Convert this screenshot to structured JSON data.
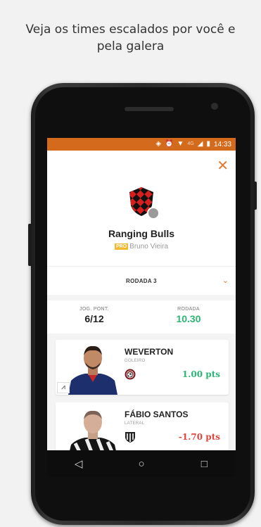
{
  "headline": {
    "line1": "Veja os times escalados por você e",
    "line2": "pela galera"
  },
  "status_bar": {
    "time": "14:33",
    "network": "4G",
    "icons": [
      "vibrate-icon",
      "alarm-icon",
      "wifi-icon",
      "signal-icon",
      "battery-icon"
    ],
    "color": "#d46a1c"
  },
  "team": {
    "name": "Ranging Bulls",
    "pro_label": "PRO",
    "owner": "Bruno Vieira"
  },
  "round_selector": {
    "label": "RODADA 3"
  },
  "stats": {
    "players_label": "JOG. PONT.",
    "players_value": "6/12",
    "round_label": "RODADA",
    "round_value": "10.30"
  },
  "players": [
    {
      "name": "WEVERTON",
      "position": "GOLEIRO",
      "points": "1.00 pts",
      "status": "positive"
    },
    {
      "name": "FÁBIO SANTOS",
      "position": "LATERAL",
      "points": "-1.70 pts",
      "status": "negative"
    }
  ],
  "navbar": {
    "back": "◁",
    "home": "○",
    "recents": "□"
  },
  "colors": {
    "accent": "#e07a2c",
    "positive": "#2bb673",
    "negative": "#e0443c",
    "pro_badge": "#f2b82f"
  }
}
